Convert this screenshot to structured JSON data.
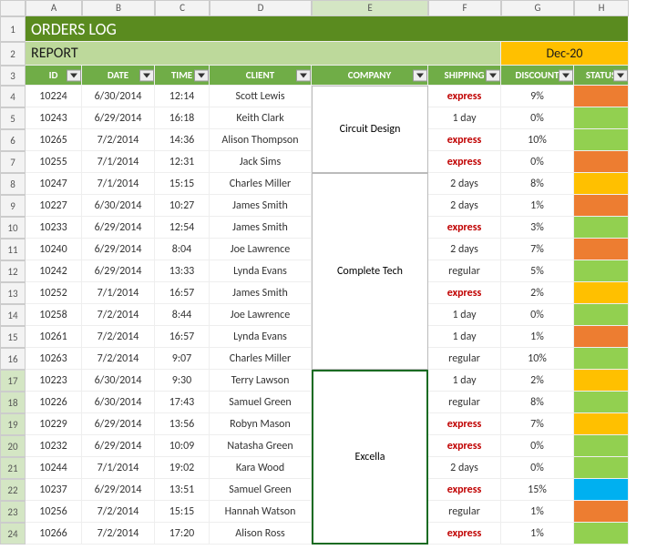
{
  "cols": [
    "A",
    "B",
    "C",
    "D",
    "E",
    "F",
    "G",
    "H"
  ],
  "title": "ORDERS LOG",
  "report_label": "REPORT",
  "report_date": "Dec-20",
  "headers": {
    "id": "ID",
    "date": "DATE",
    "time": "TIME",
    "client": "CLIENT",
    "company": "COMPANY",
    "shipping": "SHIPPING",
    "discount": "DISCOUNT",
    "status": "STATUS"
  },
  "companies": [
    {
      "name": "Circuit Design",
      "rows": 4,
      "selected": false
    },
    {
      "name": "Complete Tech",
      "rows": 9,
      "selected": false
    },
    {
      "name": "Excella",
      "rows": 8,
      "selected": true
    }
  ],
  "rows": [
    {
      "n": 4,
      "id": "10224",
      "date": "6/30/2014",
      "time": "12:14",
      "client": "Scott Lewis",
      "ship": "express",
      "disc": "9%",
      "st": "orange"
    },
    {
      "n": 5,
      "id": "10243",
      "date": "6/29/2014",
      "time": "16:18",
      "client": "Keith Clark",
      "ship": "1 day",
      "disc": "0%",
      "st": "green"
    },
    {
      "n": 6,
      "id": "10265",
      "date": "7/2/2014",
      "time": "14:36",
      "client": "Alison Thompson",
      "ship": "express",
      "disc": "10%",
      "st": "green"
    },
    {
      "n": 7,
      "id": "10255",
      "date": "7/1/2014",
      "time": "12:31",
      "client": "Jack Sims",
      "ship": "express",
      "disc": "0%",
      "st": "orange"
    },
    {
      "n": 8,
      "id": "10247",
      "date": "7/1/2014",
      "time": "15:15",
      "client": "Charles Miller",
      "ship": "2 days",
      "disc": "8%",
      "st": "yellow"
    },
    {
      "n": 9,
      "id": "10227",
      "date": "6/30/2014",
      "time": "10:27",
      "client": "James Smith",
      "ship": "2 days",
      "disc": "1%",
      "st": "orange"
    },
    {
      "n": 10,
      "id": "10233",
      "date": "6/29/2014",
      "time": "12:54",
      "client": "James Smith",
      "ship": "express",
      "disc": "3%",
      "st": "green"
    },
    {
      "n": 11,
      "id": "10240",
      "date": "6/29/2014",
      "time": "8:04",
      "client": "Joe Lawrence",
      "ship": "2 days",
      "disc": "7%",
      "st": "orange"
    },
    {
      "n": 12,
      "id": "10242",
      "date": "6/29/2014",
      "time": "13:33",
      "client": "Lynda Evans",
      "ship": "regular",
      "disc": "5%",
      "st": "green"
    },
    {
      "n": 13,
      "id": "10252",
      "date": "7/1/2014",
      "time": "16:57",
      "client": "James Smith",
      "ship": "express",
      "disc": "2%",
      "st": "yellow"
    },
    {
      "n": 14,
      "id": "10258",
      "date": "7/2/2014",
      "time": "8:44",
      "client": "Joe Lawrence",
      "ship": "1 day",
      "disc": "0%",
      "st": "green"
    },
    {
      "n": 15,
      "id": "10261",
      "date": "7/2/2014",
      "time": "16:57",
      "client": "Lynda Evans",
      "ship": "1 day",
      "disc": "1%",
      "st": "orange"
    },
    {
      "n": 16,
      "id": "10263",
      "date": "7/2/2014",
      "time": "9:07",
      "client": "Charles Miller",
      "ship": "regular",
      "disc": "10%",
      "st": "green"
    },
    {
      "n": 17,
      "id": "10223",
      "date": "6/30/2014",
      "time": "9:30",
      "client": "Terry Lawson",
      "ship": "1 day",
      "disc": "2%",
      "st": "yellow"
    },
    {
      "n": 18,
      "id": "10226",
      "date": "6/30/2014",
      "time": "17:43",
      "client": "Samuel Green",
      "ship": "regular",
      "disc": "8%",
      "st": "green"
    },
    {
      "n": 19,
      "id": "10229",
      "date": "6/29/2014",
      "time": "13:56",
      "client": "Robyn Mason",
      "ship": "express",
      "disc": "7%",
      "st": "yellow"
    },
    {
      "n": 20,
      "id": "10232",
      "date": "6/29/2014",
      "time": "10:09",
      "client": "Natasha Green",
      "ship": "express",
      "disc": "0%",
      "st": "green"
    },
    {
      "n": 21,
      "id": "10244",
      "date": "7/1/2014",
      "time": "19:02",
      "client": "Kara Wood",
      "ship": "2 days",
      "disc": "0%",
      "st": "green"
    },
    {
      "n": 22,
      "id": "10237",
      "date": "6/29/2014",
      "time": "13:51",
      "client": "Samuel Green",
      "ship": "express",
      "disc": "15%",
      "st": "blue"
    },
    {
      "n": 23,
      "id": "10256",
      "date": "7/2/2014",
      "time": "15:15",
      "client": "Hannah Watson",
      "ship": "regular",
      "disc": "1%",
      "st": "orange"
    },
    {
      "n": 24,
      "id": "10266",
      "date": "7/2/2014",
      "time": "17:20",
      "client": "Alison Ross",
      "ship": "express",
      "disc": "1%",
      "st": "green"
    }
  ]
}
